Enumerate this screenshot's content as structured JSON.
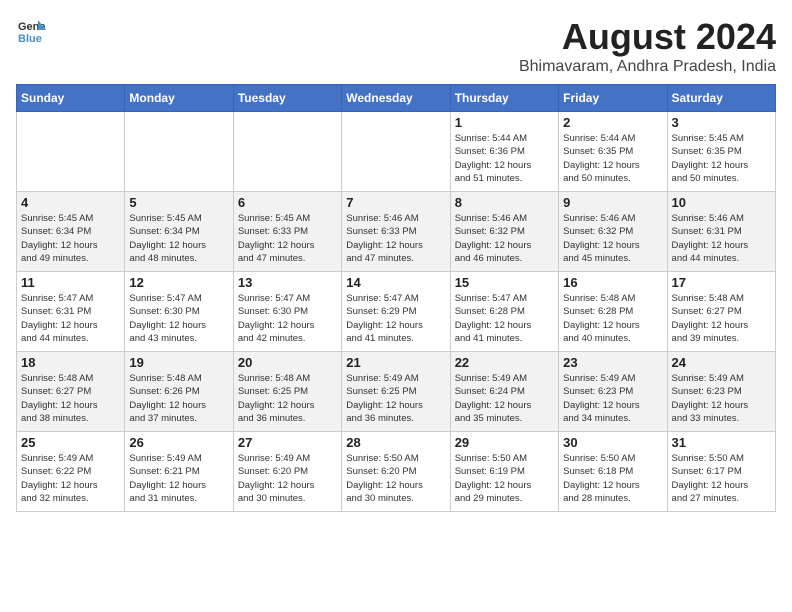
{
  "header": {
    "logo_general": "General",
    "logo_blue": "Blue",
    "title": "August 2024",
    "subtitle": "Bhimavaram, Andhra Pradesh, India"
  },
  "days_of_week": [
    "Sunday",
    "Monday",
    "Tuesday",
    "Wednesday",
    "Thursday",
    "Friday",
    "Saturday"
  ],
  "weeks": [
    [
      {
        "day": "",
        "info": ""
      },
      {
        "day": "",
        "info": ""
      },
      {
        "day": "",
        "info": ""
      },
      {
        "day": "",
        "info": ""
      },
      {
        "day": "1",
        "info": "Sunrise: 5:44 AM\nSunset: 6:36 PM\nDaylight: 12 hours\nand 51 minutes."
      },
      {
        "day": "2",
        "info": "Sunrise: 5:44 AM\nSunset: 6:35 PM\nDaylight: 12 hours\nand 50 minutes."
      },
      {
        "day": "3",
        "info": "Sunrise: 5:45 AM\nSunset: 6:35 PM\nDaylight: 12 hours\nand 50 minutes."
      }
    ],
    [
      {
        "day": "4",
        "info": "Sunrise: 5:45 AM\nSunset: 6:34 PM\nDaylight: 12 hours\nand 49 minutes."
      },
      {
        "day": "5",
        "info": "Sunrise: 5:45 AM\nSunset: 6:34 PM\nDaylight: 12 hours\nand 48 minutes."
      },
      {
        "day": "6",
        "info": "Sunrise: 5:45 AM\nSunset: 6:33 PM\nDaylight: 12 hours\nand 47 minutes."
      },
      {
        "day": "7",
        "info": "Sunrise: 5:46 AM\nSunset: 6:33 PM\nDaylight: 12 hours\nand 47 minutes."
      },
      {
        "day": "8",
        "info": "Sunrise: 5:46 AM\nSunset: 6:32 PM\nDaylight: 12 hours\nand 46 minutes."
      },
      {
        "day": "9",
        "info": "Sunrise: 5:46 AM\nSunset: 6:32 PM\nDaylight: 12 hours\nand 45 minutes."
      },
      {
        "day": "10",
        "info": "Sunrise: 5:46 AM\nSunset: 6:31 PM\nDaylight: 12 hours\nand 44 minutes."
      }
    ],
    [
      {
        "day": "11",
        "info": "Sunrise: 5:47 AM\nSunset: 6:31 PM\nDaylight: 12 hours\nand 44 minutes."
      },
      {
        "day": "12",
        "info": "Sunrise: 5:47 AM\nSunset: 6:30 PM\nDaylight: 12 hours\nand 43 minutes."
      },
      {
        "day": "13",
        "info": "Sunrise: 5:47 AM\nSunset: 6:30 PM\nDaylight: 12 hours\nand 42 minutes."
      },
      {
        "day": "14",
        "info": "Sunrise: 5:47 AM\nSunset: 6:29 PM\nDaylight: 12 hours\nand 41 minutes."
      },
      {
        "day": "15",
        "info": "Sunrise: 5:47 AM\nSunset: 6:28 PM\nDaylight: 12 hours\nand 41 minutes."
      },
      {
        "day": "16",
        "info": "Sunrise: 5:48 AM\nSunset: 6:28 PM\nDaylight: 12 hours\nand 40 minutes."
      },
      {
        "day": "17",
        "info": "Sunrise: 5:48 AM\nSunset: 6:27 PM\nDaylight: 12 hours\nand 39 minutes."
      }
    ],
    [
      {
        "day": "18",
        "info": "Sunrise: 5:48 AM\nSunset: 6:27 PM\nDaylight: 12 hours\nand 38 minutes."
      },
      {
        "day": "19",
        "info": "Sunrise: 5:48 AM\nSunset: 6:26 PM\nDaylight: 12 hours\nand 37 minutes."
      },
      {
        "day": "20",
        "info": "Sunrise: 5:48 AM\nSunset: 6:25 PM\nDaylight: 12 hours\nand 36 minutes."
      },
      {
        "day": "21",
        "info": "Sunrise: 5:49 AM\nSunset: 6:25 PM\nDaylight: 12 hours\nand 36 minutes."
      },
      {
        "day": "22",
        "info": "Sunrise: 5:49 AM\nSunset: 6:24 PM\nDaylight: 12 hours\nand 35 minutes."
      },
      {
        "day": "23",
        "info": "Sunrise: 5:49 AM\nSunset: 6:23 PM\nDaylight: 12 hours\nand 34 minutes."
      },
      {
        "day": "24",
        "info": "Sunrise: 5:49 AM\nSunset: 6:23 PM\nDaylight: 12 hours\nand 33 minutes."
      }
    ],
    [
      {
        "day": "25",
        "info": "Sunrise: 5:49 AM\nSunset: 6:22 PM\nDaylight: 12 hours\nand 32 minutes."
      },
      {
        "day": "26",
        "info": "Sunrise: 5:49 AM\nSunset: 6:21 PM\nDaylight: 12 hours\nand 31 minutes."
      },
      {
        "day": "27",
        "info": "Sunrise: 5:49 AM\nSunset: 6:20 PM\nDaylight: 12 hours\nand 30 minutes."
      },
      {
        "day": "28",
        "info": "Sunrise: 5:50 AM\nSunset: 6:20 PM\nDaylight: 12 hours\nand 30 minutes."
      },
      {
        "day": "29",
        "info": "Sunrise: 5:50 AM\nSunset: 6:19 PM\nDaylight: 12 hours\nand 29 minutes."
      },
      {
        "day": "30",
        "info": "Sunrise: 5:50 AM\nSunset: 6:18 PM\nDaylight: 12 hours\nand 28 minutes."
      },
      {
        "day": "31",
        "info": "Sunrise: 5:50 AM\nSunset: 6:17 PM\nDaylight: 12 hours\nand 27 minutes."
      }
    ]
  ]
}
